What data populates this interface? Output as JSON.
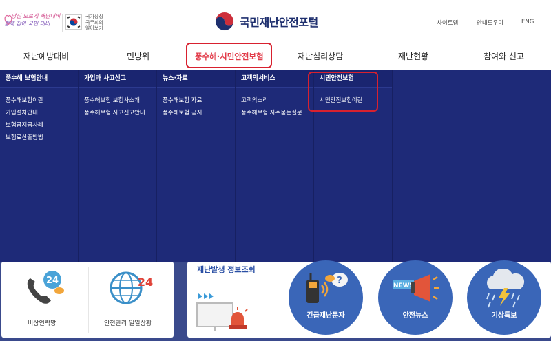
{
  "header": {
    "slogan_line1": "당신 모르게 재난대비",
    "slogan_line2": "함께 잡아 국민 대비",
    "gov_lines": [
      "국가상징",
      "국무회의",
      "알아보기"
    ],
    "logo_title": "국민재난안전포털",
    "utility": [
      "사이트맵",
      "안내도우미",
      "ENG"
    ]
  },
  "nav": {
    "items": [
      "재난예방대비",
      "민방위",
      "풍수해·시민안전보험",
      "재난심리상담",
      "재난현황",
      "참여와 신고"
    ],
    "active_index": 2
  },
  "mega_menu": {
    "columns": [
      {
        "title": "풍수해 보험안내",
        "links": [
          "풍수해보험이란",
          "가입절차안내",
          "보험금지급사례",
          "보험료산출방법"
        ]
      },
      {
        "title": "가입과 사고신고",
        "links": [
          "풍수해보험 보험사소개",
          "풍수해보험 사고신고안내"
        ]
      },
      {
        "title": "뉴스·자료",
        "links": [
          "풍수해보험 자료",
          "풍수해보험 공지"
        ]
      },
      {
        "title": "고객의서비스",
        "links": [
          "고객의소리",
          "풍수해보험 자주묻는질문"
        ]
      },
      {
        "title": "시민안전보험",
        "links": [
          "시민안전보험이란"
        ]
      }
    ]
  },
  "lower": {
    "left_card": {
      "emergency_label": "비상연락망",
      "daily_label": "안전관리 일일상황",
      "badge_24": "24"
    },
    "info_title": "재난발생 정보조회",
    "circles": [
      "긴급재난문자",
      "안전뉴스",
      "기상특보"
    ],
    "news_badge": "NEWS"
  },
  "colors": {
    "navy": "#1e2a78",
    "highlight_red": "#d8212f",
    "active_text": "#e23c4a",
    "circle_blue": "#3a66b8"
  }
}
